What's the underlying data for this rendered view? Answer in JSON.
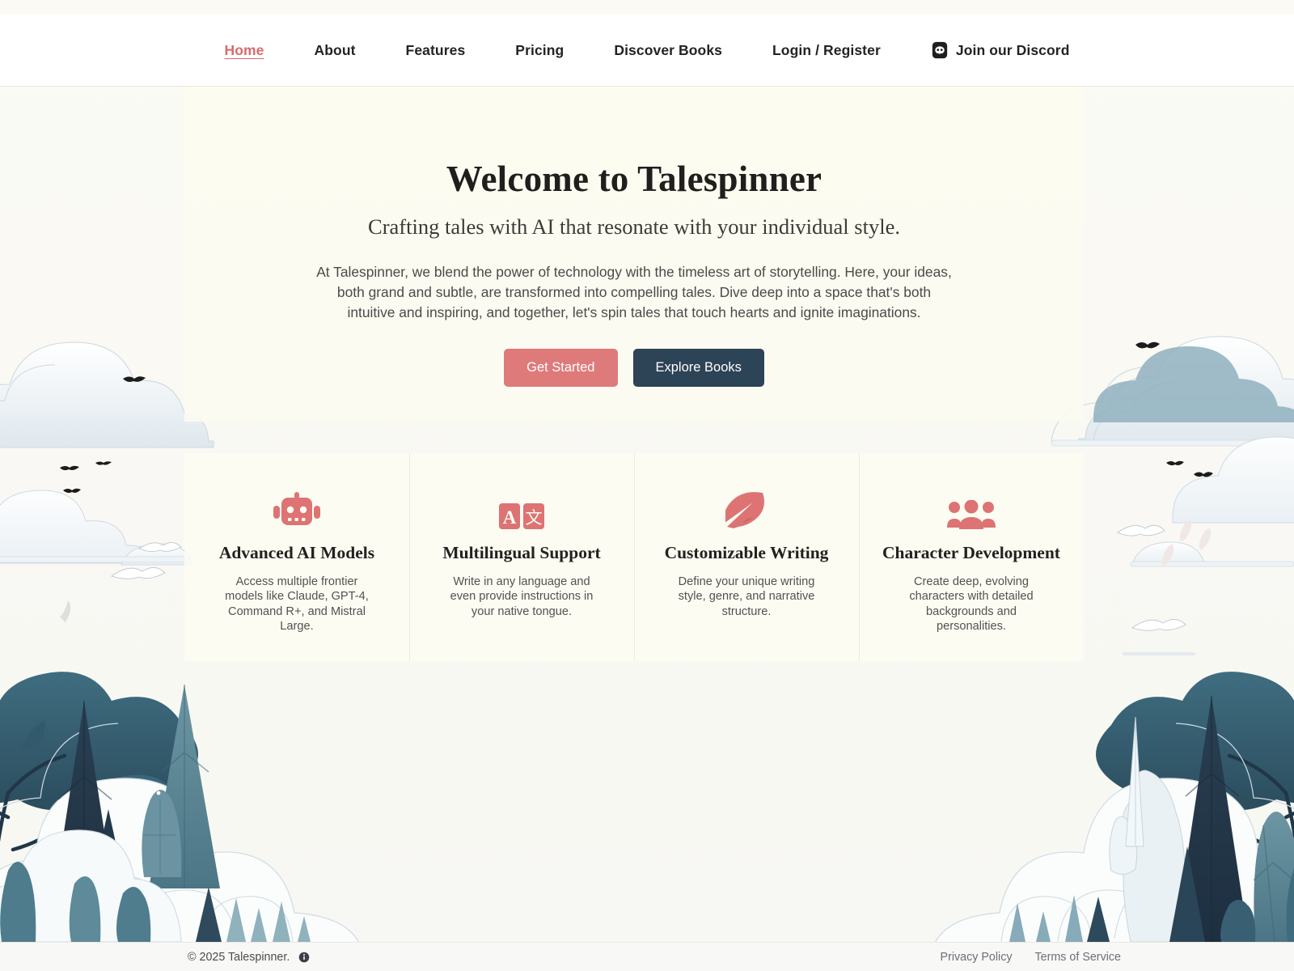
{
  "nav": {
    "items": [
      {
        "label": "Home",
        "active": true
      },
      {
        "label": "About",
        "active": false
      },
      {
        "label": "Features",
        "active": false
      },
      {
        "label": "Pricing",
        "active": false
      },
      {
        "label": "Discover Books",
        "active": false
      },
      {
        "label": "Login / Register",
        "active": false
      }
    ],
    "discord": {
      "icon": "discord-icon",
      "label": "Join our Discord"
    }
  },
  "hero": {
    "title": "Welcome to Talespinner",
    "subtitle": "Crafting tales with AI that resonate with your individual style.",
    "body": "At Talespinner, we blend the power of technology with the timeless art of storytelling. Here, your ideas, both grand and subtle, are transformed into compelling tales. Dive deep into a space that's both intuitive and inspiring, and together, let's spin tales that touch hearts and ignite imaginations.",
    "primary_button": "Get Started",
    "secondary_button": "Explore Books"
  },
  "features": [
    {
      "icon": "robot-icon",
      "title": "Advanced AI Models",
      "description": "Access multiple frontier models like Claude, GPT-4, Command R+, and Mistral Large."
    },
    {
      "icon": "translate-icon",
      "title": "Multilingual Support",
      "description": "Write in any language and even provide instructions in your native tongue."
    },
    {
      "icon": "feather-icon",
      "title": "Customizable Writing",
      "description": "Define your unique writing style, genre, and narrative structure."
    },
    {
      "icon": "people-group-icon",
      "title": "Character Development",
      "description": "Create deep, evolving characters with detailed backgrounds and personalities."
    }
  ],
  "footer": {
    "copyright": "© 2025 Talespinner.",
    "info_icon": "info-icon",
    "links": [
      {
        "label": "Privacy Policy"
      },
      {
        "label": "Terms of Service"
      }
    ]
  },
  "theme": {
    "accent": "#df7a7a",
    "dark": "#2d4356",
    "page_background": "#fbfaf4",
    "header_background": "#ffffff",
    "footer_background": "#f8f8f6",
    "illustration_deep_teal": "#2c4a5a",
    "illustration_mid_teal": "#4f7e8e",
    "illustration_cloud": "#e9eff3"
  }
}
